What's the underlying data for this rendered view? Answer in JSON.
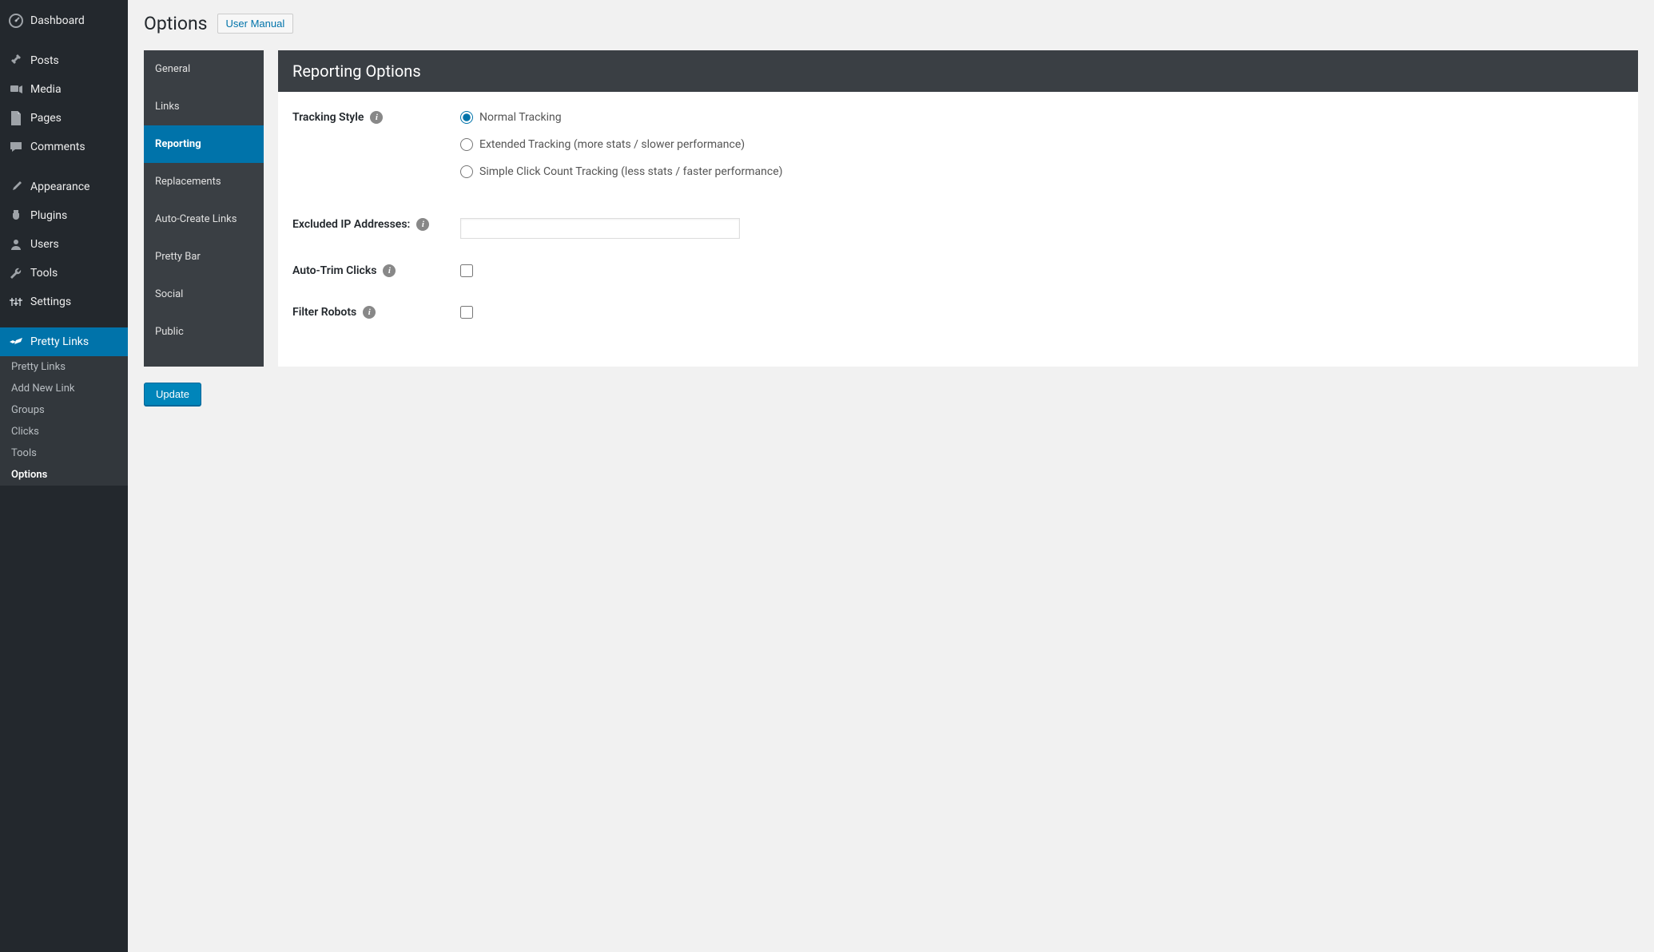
{
  "sidebar": {
    "items": [
      {
        "label": "Dashboard",
        "icon": "dashboard"
      },
      {
        "label": "Posts",
        "icon": "pin"
      },
      {
        "label": "Media",
        "icon": "media"
      },
      {
        "label": "Pages",
        "icon": "page"
      },
      {
        "label": "Comments",
        "icon": "comment"
      },
      {
        "label": "Appearance",
        "icon": "brush"
      },
      {
        "label": "Plugins",
        "icon": "plug"
      },
      {
        "label": "Users",
        "icon": "user"
      },
      {
        "label": "Tools",
        "icon": "wrench"
      },
      {
        "label": "Settings",
        "icon": "settings"
      },
      {
        "label": "Pretty Links",
        "icon": "star",
        "active": true
      }
    ],
    "submenu": [
      {
        "label": "Pretty Links"
      },
      {
        "label": "Add New Link"
      },
      {
        "label": "Groups"
      },
      {
        "label": "Clicks"
      },
      {
        "label": "Tools"
      },
      {
        "label": "Options",
        "current": true
      }
    ]
  },
  "header": {
    "title": "Options",
    "manual_button": "User Manual"
  },
  "tabs": [
    {
      "label": "General"
    },
    {
      "label": "Links"
    },
    {
      "label": "Reporting",
      "active": true
    },
    {
      "label": "Replacements"
    },
    {
      "label": "Auto-Create Links"
    },
    {
      "label": "Pretty Bar"
    },
    {
      "label": "Social"
    },
    {
      "label": "Public"
    }
  ],
  "panel": {
    "title": "Reporting Options",
    "tracking_label": "Tracking Style",
    "tracking_options": [
      {
        "label": "Normal Tracking",
        "checked": true
      },
      {
        "label": "Extended Tracking (more stats / slower performance)",
        "checked": false
      },
      {
        "label": "Simple Click Count Tracking (less stats / faster performance)",
        "checked": false
      }
    ],
    "excluded_ip_label": "Excluded IP Addresses:",
    "excluded_ip_value": "",
    "auto_trim_label": "Auto-Trim Clicks",
    "auto_trim_checked": false,
    "filter_robots_label": "Filter Robots",
    "filter_robots_checked": false
  },
  "buttons": {
    "update": "Update"
  }
}
